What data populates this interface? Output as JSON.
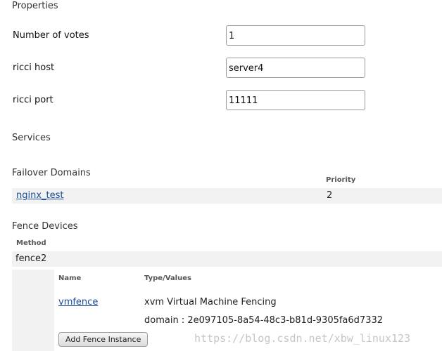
{
  "properties": {
    "title": "Properties",
    "votes_label": "Number of votes",
    "votes_value": "1",
    "host_label": "ricci host",
    "host_value": "server4",
    "port_label": "ricci port",
    "port_value": "11111"
  },
  "services": {
    "title": "Services"
  },
  "failover": {
    "title": "Failover Domains",
    "priority_header": "Priority",
    "rows": [
      {
        "name": "nginx_test",
        "priority": "2"
      }
    ]
  },
  "fence": {
    "title": "Fence Devices",
    "method_header": "Method",
    "method_name": "fence2",
    "name_header": "Name",
    "type_header": "Type/Values",
    "instance_name": "vmfence",
    "instance_type": "xvm Virtual Machine Fencing",
    "instance_domain": "domain : 2e097105-8a54-48c3-b81d-9305fa6d7332",
    "add_instance_label": "Add Fence Instance"
  },
  "watermark": "https://blog.csdn.net/xbw_linux123"
}
